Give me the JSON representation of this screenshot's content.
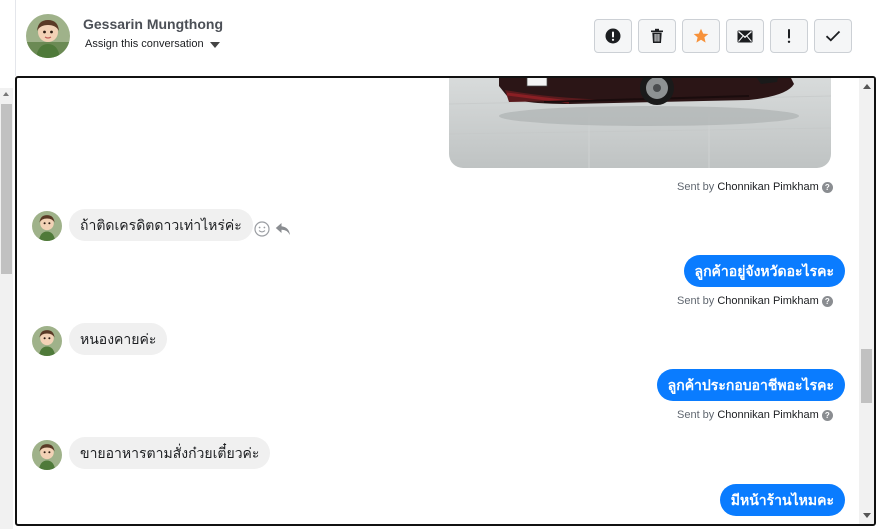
{
  "header": {
    "contact_name": "Gessarin Mungthong",
    "assign_label": "Assign this conversation",
    "actions": [
      {
        "name": "spam",
        "icon": "alert-circle-icon"
      },
      {
        "name": "delete",
        "icon": "trash-icon"
      },
      {
        "name": "star",
        "icon": "star-icon",
        "color": "#f7923b"
      },
      {
        "name": "mark-unread",
        "icon": "envelope-icon"
      },
      {
        "name": "follow-up",
        "icon": "exclamation-icon"
      },
      {
        "name": "mark-done",
        "icon": "checkmark-icon"
      }
    ]
  },
  "conversation": {
    "sent_by_prefix": "Sent by",
    "agent_name": "Chonnikan Pimkham",
    "messages": [
      {
        "direction": "incoming",
        "text": "ถ้าติดเครดิตดาวเท่าไหร่ค่ะ"
      },
      {
        "direction": "outgoing",
        "text": "ลูกค้าอยู่จังหวัดอะไรคะ"
      },
      {
        "direction": "incoming",
        "text": "หนองคายค่ะ"
      },
      {
        "direction": "outgoing",
        "text": "ลูกค้าประกอบอาชีพอะไรคะ"
      },
      {
        "direction": "incoming",
        "text": "ขายอาหารตามสั่งก๋วยเตี๋ยวค่ะ"
      },
      {
        "direction": "outgoing",
        "text": "มีหน้าร้านไหมคะ"
      }
    ]
  },
  "colors": {
    "accent": "#0a7cff",
    "incoming_bubble": "#f0f0f0",
    "star": "#f7923b"
  }
}
